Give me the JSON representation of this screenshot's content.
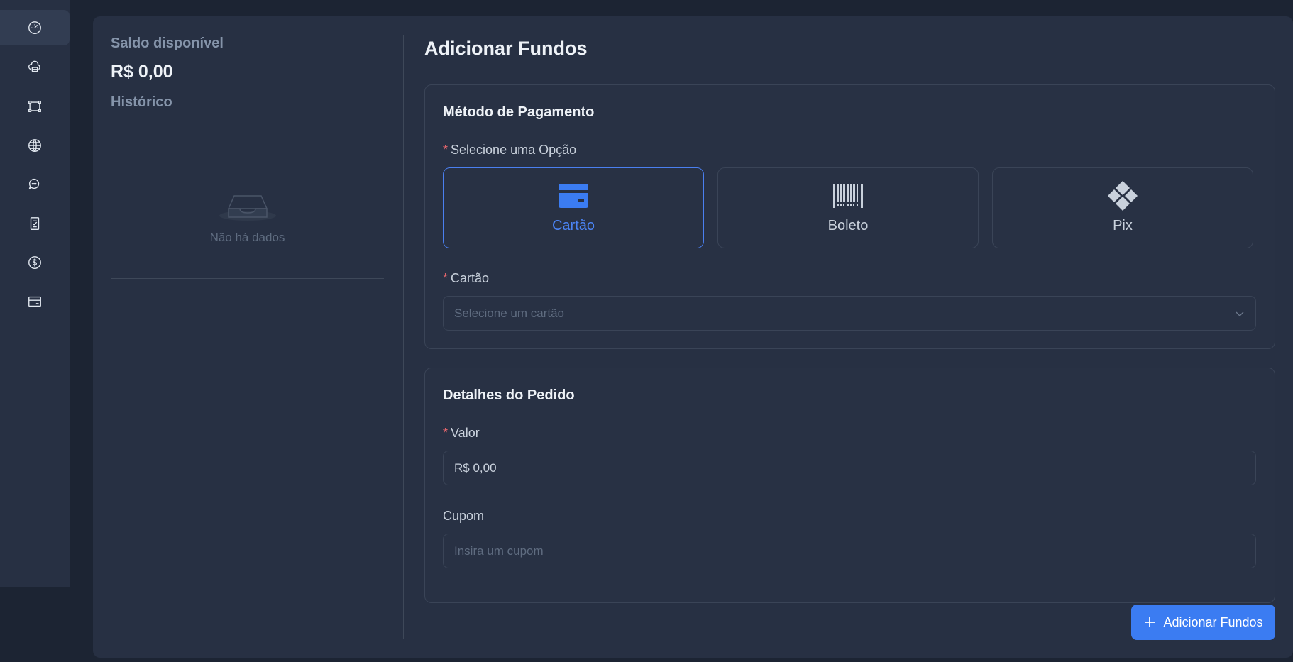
{
  "sidebar": {
    "items": [
      {
        "icon": "dashboard-icon",
        "active": true
      },
      {
        "icon": "cloud-server-icon",
        "active": false
      },
      {
        "icon": "nodes-icon",
        "active": false
      },
      {
        "icon": "globe-icon",
        "active": false
      },
      {
        "icon": "chat-icon",
        "active": false
      },
      {
        "icon": "invoice-icon",
        "active": false
      },
      {
        "icon": "dollar-icon",
        "active": false
      },
      {
        "icon": "credit-card-icon",
        "active": false
      }
    ]
  },
  "balance": {
    "label": "Saldo disponível",
    "value": "R$ 0,00",
    "history_label": "Histórico",
    "empty_text": "Não há dados"
  },
  "page": {
    "title": "Adicionar Fundos"
  },
  "payment": {
    "title": "Método de Pagamento",
    "option_label": "Selecione uma Opção",
    "options": [
      {
        "label": "Cartão",
        "icon": "credit-card-icon",
        "selected": true
      },
      {
        "label": "Boleto",
        "icon": "barcode-icon",
        "selected": false
      },
      {
        "label": "Pix",
        "icon": "pix-icon",
        "selected": false
      }
    ],
    "card_label": "Cartão",
    "card_placeholder": "Selecione um cartão"
  },
  "order": {
    "title": "Detalhes do Pedido",
    "value_label": "Valor",
    "value": "R$ 0,00",
    "coupon_label": "Cupom",
    "coupon_placeholder": "Insira um cupom"
  },
  "actions": {
    "add_funds": "Adicionar Fundos"
  },
  "colors": {
    "accent": "#3b7cf2",
    "required": "#e0646b",
    "background": "#1c2433",
    "panel": "#273043"
  }
}
